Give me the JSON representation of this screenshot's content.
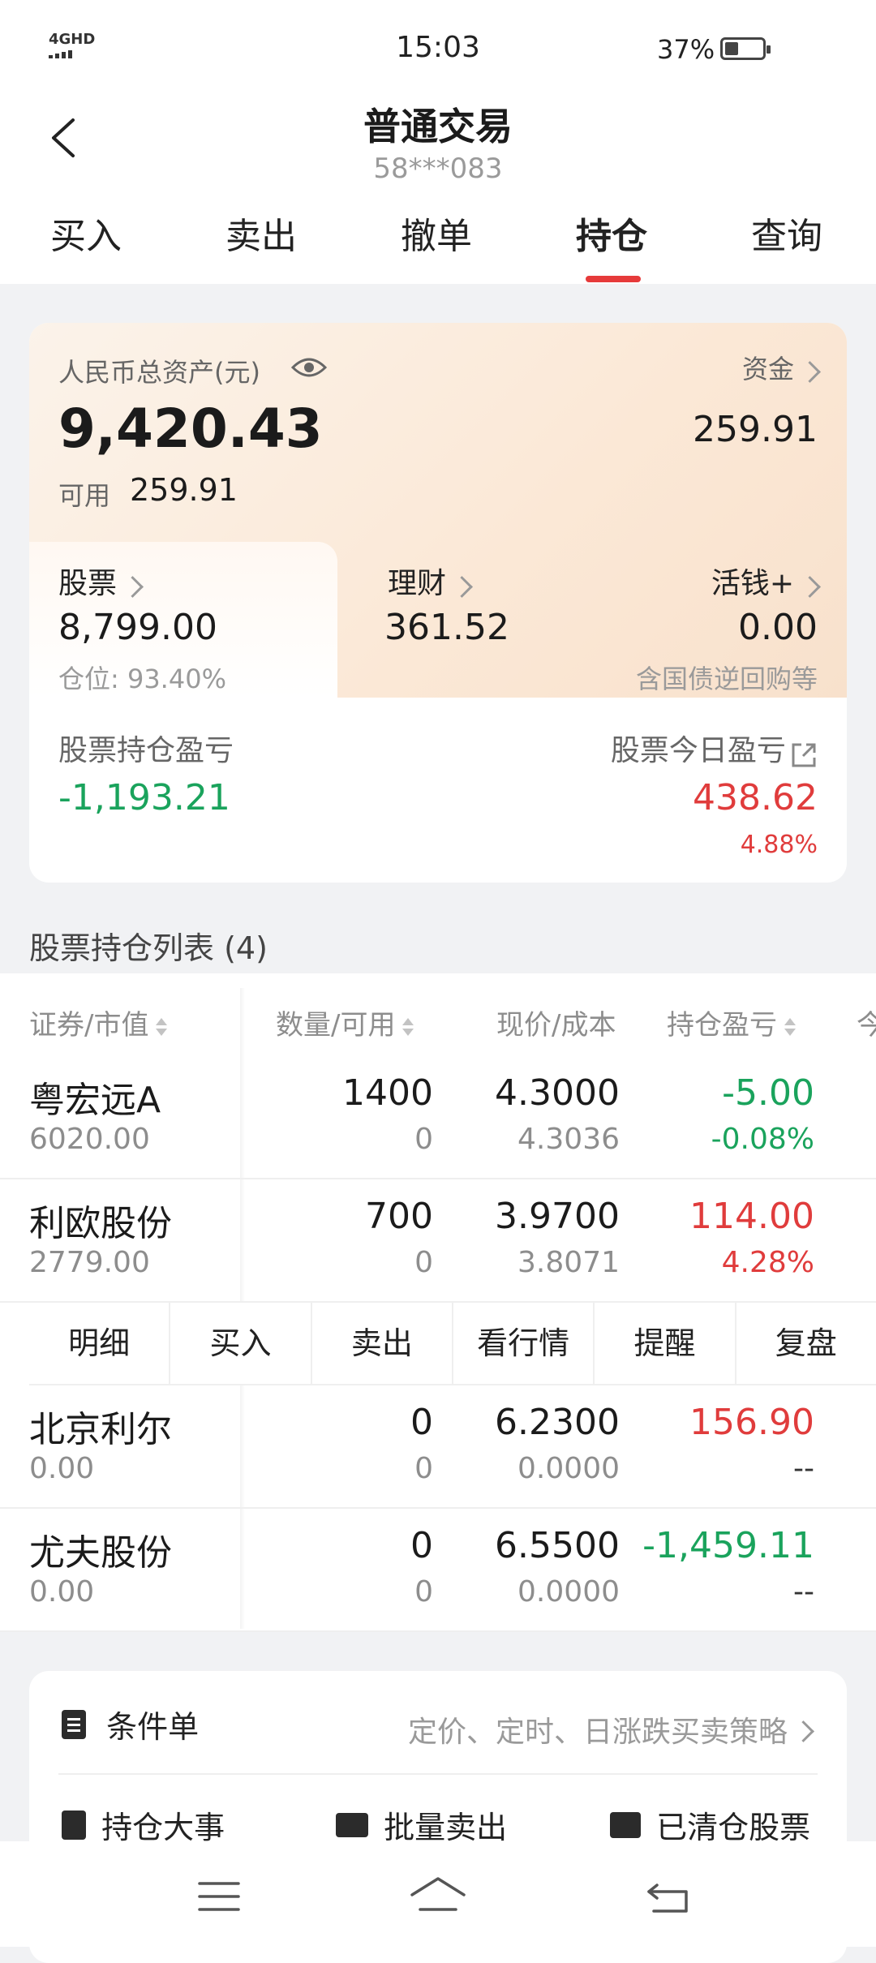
{
  "status_bar": {
    "network": "4GHD",
    "time": "15:03",
    "battery": "37%"
  },
  "header": {
    "title": "普通交易",
    "account": "58***083"
  },
  "tabs": [
    {
      "label": "买入",
      "active": false
    },
    {
      "label": "卖出",
      "active": false
    },
    {
      "label": "撤单",
      "active": false
    },
    {
      "label": "持仓",
      "active": true
    },
    {
      "label": "查询",
      "active": false
    }
  ],
  "assets": {
    "total_label": "人民币总资产(元)",
    "total_value": "9,420.43",
    "available_label": "可用",
    "available_value": "259.91",
    "fund_label": "资金",
    "fund_value": "259.91",
    "stock_label": "股票",
    "stock_value": "8,799.00",
    "position_ratio": "仓位: 93.40%",
    "wealth_label": "理财",
    "wealth_value": "361.52",
    "huoqian_label": "活钱+",
    "huoqian_value": "0.00",
    "huoqian_note": "含国债逆回购等",
    "holding_pl_label": "股票持仓盈亏",
    "holding_pl_value": "-1,193.21",
    "today_pl_label": "股票今日盈亏",
    "today_pl_value": "438.62",
    "today_pl_percent": "4.88%"
  },
  "holdings": {
    "title": "股票持仓列表 (4)",
    "columns": [
      "证券/市值",
      "数量/可用",
      "现价/成本",
      "持仓盈亏",
      "今"
    ],
    "rows": [
      {
        "name": "粤宏远A",
        "market_value": "6020.00",
        "quantity": "1400",
        "available": "0",
        "price": "4.3000",
        "cost": "4.3036",
        "pl": "-5.00",
        "pl_percent": "-0.08%",
        "pl_color": "green",
        "pct_color": "green"
      },
      {
        "name": "利欧股份",
        "market_value": "2779.00",
        "quantity": "700",
        "available": "0",
        "price": "3.9700",
        "cost": "3.8071",
        "pl": "114.00",
        "pl_percent": "4.28%",
        "pl_color": "red",
        "pct_color": "red"
      },
      {
        "name": "北京利尔",
        "market_value": "0.00",
        "quantity": "0",
        "available": "0",
        "price": "6.2300",
        "cost": "0.0000",
        "pl": "156.90",
        "pl_percent": "--",
        "pl_color": "red",
        "pct_color": "dark"
      },
      {
        "name": "尤夫股份",
        "market_value": "0.00",
        "quantity": "0",
        "available": "0",
        "price": "6.5500",
        "cost": "0.0000",
        "pl": "-1,459.11",
        "pl_percent": "--",
        "pl_color": "green",
        "pct_color": "dark"
      }
    ],
    "row_actions": [
      "明细",
      "买入",
      "卖出",
      "看行情",
      "提醒",
      "复盘"
    ]
  },
  "tools": {
    "conditional_label": "条件单",
    "conditional_desc": "定价、定时、日涨跌买卖策略",
    "items": [
      "持仓大事",
      "批量卖出",
      "已清仓股票"
    ]
  },
  "colors": {
    "red": "#e03c3c",
    "green": "#1aa35c",
    "accent": "#e63a3a"
  }
}
